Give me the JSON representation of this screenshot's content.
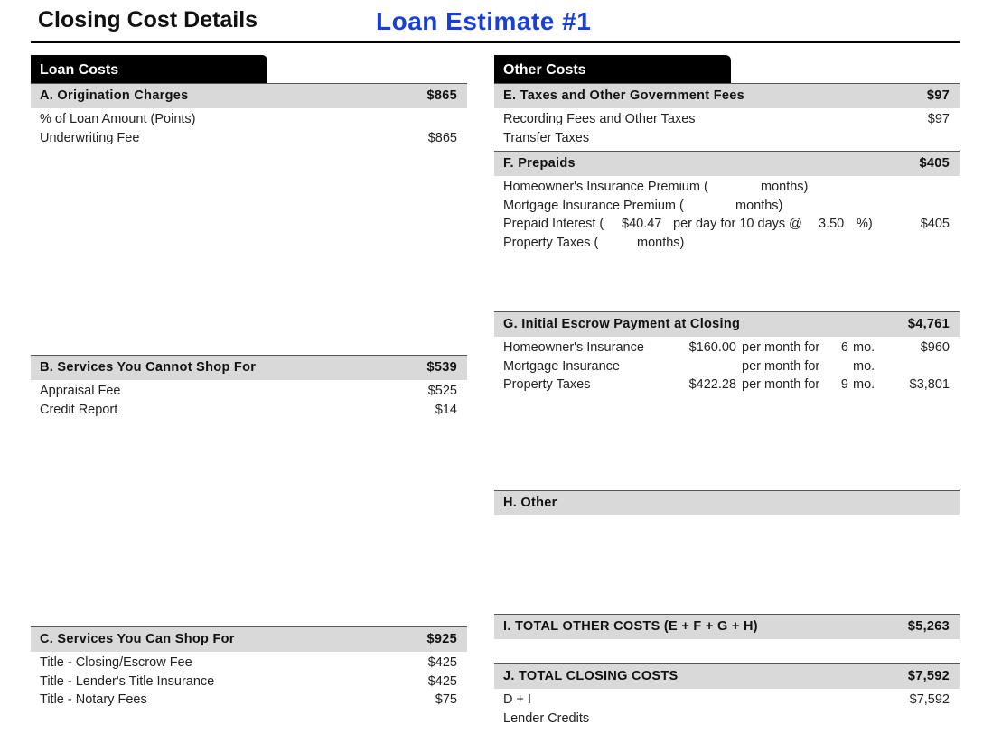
{
  "header": {
    "title": "Closing Cost Details",
    "estimate": "Loan Estimate #1"
  },
  "loan_costs": {
    "tab": "Loan Costs",
    "A": {
      "label": "A. Origination Charges",
      "amount": "$865",
      "items": [
        {
          "label": "% of Loan Amount (Points)",
          "amount": ""
        },
        {
          "label": "Underwriting Fee",
          "amount": "$865"
        }
      ]
    },
    "B": {
      "label": "B. Services You Cannot Shop For",
      "amount": "$539",
      "items": [
        {
          "label": "Appraisal Fee",
          "amount": "$525"
        },
        {
          "label": "Credit Report",
          "amount": "$14"
        }
      ]
    },
    "C": {
      "label": "C. Services You Can Shop For",
      "amount": "$925",
      "items": [
        {
          "label": "Title - Closing/Escrow Fee",
          "amount": "$425"
        },
        {
          "label": "Title - Lender's Title Insurance",
          "amount": "$425"
        },
        {
          "label": "Title - Notary Fees",
          "amount": "$75"
        }
      ]
    }
  },
  "other_costs": {
    "tab": "Other Costs",
    "E": {
      "label": "E. Taxes and Other Government Fees",
      "amount": "$97",
      "items": [
        {
          "label": "Recording Fees and Other Taxes",
          "amount": "$97"
        },
        {
          "label": "Transfer Taxes",
          "amount": ""
        }
      ]
    },
    "F": {
      "label": "F. Prepaids",
      "amount": "$405",
      "hoi": {
        "pre": "Homeowner's Insurance Premium (",
        "post": "months)"
      },
      "mip": {
        "pre": "Mortgage Insurance Premium (",
        "post": "months)"
      },
      "interest": {
        "pre": "Prepaid Interest (",
        "per_day": "$40.47",
        "mid": "per day for 10 days @",
        "rate": "3.50",
        "post": "%)",
        "amount": "$405"
      },
      "taxes": {
        "pre": "Property Taxes (",
        "post": "months)"
      }
    },
    "G": {
      "label": "G. Initial Escrow Payment at Closing",
      "amount": "$4,761",
      "per_month_label": "per month for",
      "mo_label": "mo.",
      "items": [
        {
          "label": "Homeowner's Insurance",
          "monthly": "$160.00",
          "months": "6",
          "amount": "$960"
        },
        {
          "label": "Mortgage Insurance",
          "monthly": "",
          "months": "",
          "amount": ""
        },
        {
          "label": "Property Taxes",
          "monthly": "$422.28",
          "months": "9",
          "amount": "$3,801"
        }
      ]
    },
    "H": {
      "label": "H. Other"
    },
    "I": {
      "label": "I. TOTAL OTHER COSTS (E + F + G + H)",
      "amount": "$5,263"
    },
    "J": {
      "label": "J. TOTAL CLOSING COSTS",
      "amount": "$7,592",
      "items": [
        {
          "label": "D + I",
          "amount": "$7,592"
        },
        {
          "label": "Lender Credits",
          "amount": ""
        }
      ]
    }
  }
}
